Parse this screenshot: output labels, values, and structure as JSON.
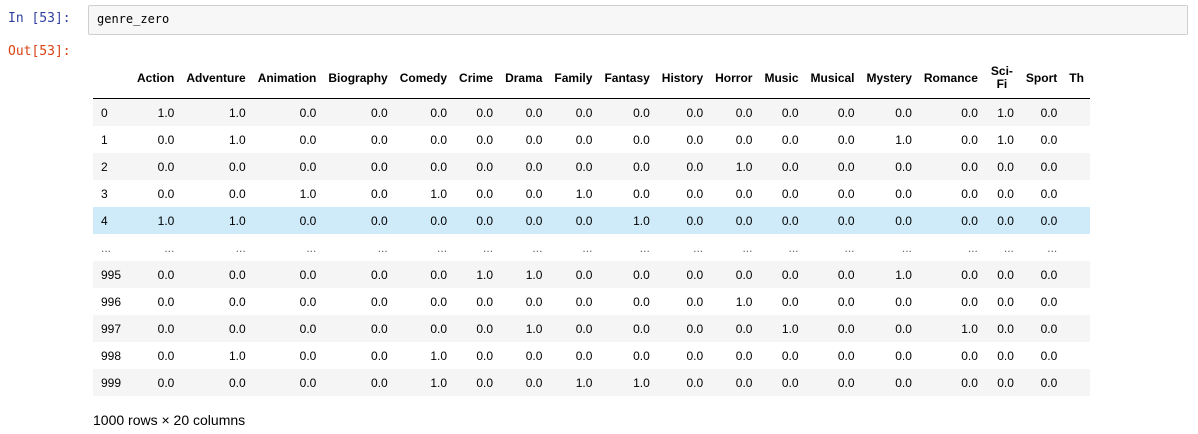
{
  "cell": {
    "in_prompt": "In  [53]:",
    "code": "genre_zero",
    "out_prompt": "Out[53]:"
  },
  "table": {
    "columns": [
      "Action",
      "Adventure",
      "Animation",
      "Biography",
      "Comedy",
      "Crime",
      "Drama",
      "Family",
      "Fantasy",
      "History",
      "Horror",
      "Music",
      "Musical",
      "Mystery",
      "Romance",
      "Sci-Fi",
      "Sport",
      "Th"
    ],
    "rows": [
      {
        "index": "0",
        "values": [
          "1.0",
          "1.0",
          "0.0",
          "0.0",
          "0.0",
          "0.0",
          "0.0",
          "0.0",
          "0.0",
          "0.0",
          "0.0",
          "0.0",
          "0.0",
          "0.0",
          "0.0",
          "1.0",
          "0.0",
          ""
        ]
      },
      {
        "index": "1",
        "values": [
          "0.0",
          "1.0",
          "0.0",
          "0.0",
          "0.0",
          "0.0",
          "0.0",
          "0.0",
          "0.0",
          "0.0",
          "0.0",
          "0.0",
          "0.0",
          "1.0",
          "0.0",
          "1.0",
          "0.0",
          ""
        ]
      },
      {
        "index": "2",
        "values": [
          "0.0",
          "0.0",
          "0.0",
          "0.0",
          "0.0",
          "0.0",
          "0.0",
          "0.0",
          "0.0",
          "0.0",
          "1.0",
          "0.0",
          "0.0",
          "0.0",
          "0.0",
          "0.0",
          "0.0",
          ""
        ]
      },
      {
        "index": "3",
        "values": [
          "0.0",
          "0.0",
          "1.0",
          "0.0",
          "1.0",
          "0.0",
          "0.0",
          "1.0",
          "0.0",
          "0.0",
          "0.0",
          "0.0",
          "0.0",
          "0.0",
          "0.0",
          "0.0",
          "0.0",
          ""
        ]
      },
      {
        "index": "4",
        "values": [
          "1.0",
          "1.0",
          "0.0",
          "0.0",
          "0.0",
          "0.0",
          "0.0",
          "0.0",
          "1.0",
          "0.0",
          "0.0",
          "0.0",
          "0.0",
          "0.0",
          "0.0",
          "0.0",
          "0.0",
          ""
        ],
        "highlight": true
      },
      {
        "index": "...",
        "values": [
          "...",
          "...",
          "...",
          "...",
          "...",
          "...",
          "...",
          "...",
          "...",
          "...",
          "...",
          "...",
          "...",
          "...",
          "...",
          "...",
          "...",
          ""
        ],
        "ellipsis": true
      },
      {
        "index": "995",
        "values": [
          "0.0",
          "0.0",
          "0.0",
          "0.0",
          "0.0",
          "1.0",
          "1.0",
          "0.0",
          "0.0",
          "0.0",
          "0.0",
          "0.0",
          "0.0",
          "1.0",
          "0.0",
          "0.0",
          "0.0",
          ""
        ]
      },
      {
        "index": "996",
        "values": [
          "0.0",
          "0.0",
          "0.0",
          "0.0",
          "0.0",
          "0.0",
          "0.0",
          "0.0",
          "0.0",
          "0.0",
          "1.0",
          "0.0",
          "0.0",
          "0.0",
          "0.0",
          "0.0",
          "0.0",
          ""
        ]
      },
      {
        "index": "997",
        "values": [
          "0.0",
          "0.0",
          "0.0",
          "0.0",
          "0.0",
          "0.0",
          "1.0",
          "0.0",
          "0.0",
          "0.0",
          "0.0",
          "1.0",
          "0.0",
          "0.0",
          "1.0",
          "0.0",
          "0.0",
          ""
        ]
      },
      {
        "index": "998",
        "values": [
          "0.0",
          "1.0",
          "0.0",
          "0.0",
          "1.0",
          "0.0",
          "0.0",
          "0.0",
          "0.0",
          "0.0",
          "0.0",
          "0.0",
          "0.0",
          "0.0",
          "0.0",
          "0.0",
          "0.0",
          ""
        ]
      },
      {
        "index": "999",
        "values": [
          "0.0",
          "0.0",
          "0.0",
          "0.0",
          "1.0",
          "0.0",
          "0.0",
          "1.0",
          "1.0",
          "0.0",
          "0.0",
          "0.0",
          "0.0",
          "0.0",
          "0.0",
          "0.0",
          "0.0",
          ""
        ]
      }
    ],
    "summary": "1000 rows × 20 columns"
  }
}
